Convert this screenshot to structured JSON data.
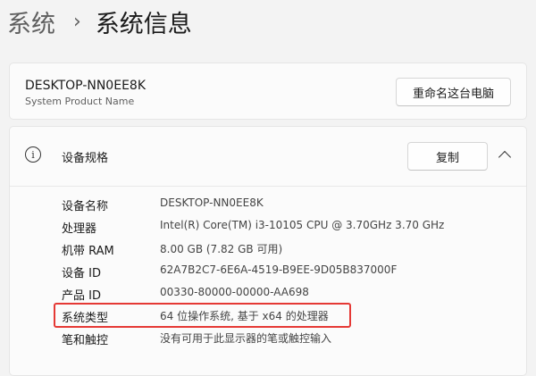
{
  "breadcrumb": {
    "parent": "系统",
    "separator": "›",
    "current": "系统信息"
  },
  "device": {
    "name": "DESKTOP-NN0EE8K",
    "subtitle": "System Product Name",
    "rename_label": "重命名这台电脑"
  },
  "specs": {
    "icon": "info-icon",
    "title": "设备规格",
    "copy_label": "复制",
    "collapse_icon": "chevron-up-icon",
    "rows": [
      {
        "label": "设备名称",
        "value": "DESKTOP-NN0EE8K"
      },
      {
        "label": "处理器",
        "value": "Intel(R) Core(TM) i3-10105 CPU @ 3.70GHz   3.70 GHz"
      },
      {
        "label": "机带 RAM",
        "value": "8.00 GB (7.82 GB 可用)"
      },
      {
        "label": "设备 ID",
        "value": "62A7B2C7-6E6A-4519-B9EE-9D05B837000F"
      },
      {
        "label": "产品 ID",
        "value": "00330-80000-00000-AA698"
      },
      {
        "label": "系统类型",
        "value": "64 位操作系统, 基于 x64 的处理器"
      },
      {
        "label": "笔和触控",
        "value": "没有可用于此显示器的笔或触控输入"
      }
    ]
  },
  "colors": {
    "highlight": "#e53935",
    "background": "#f3f3f3",
    "card": "#fbfbfb"
  }
}
